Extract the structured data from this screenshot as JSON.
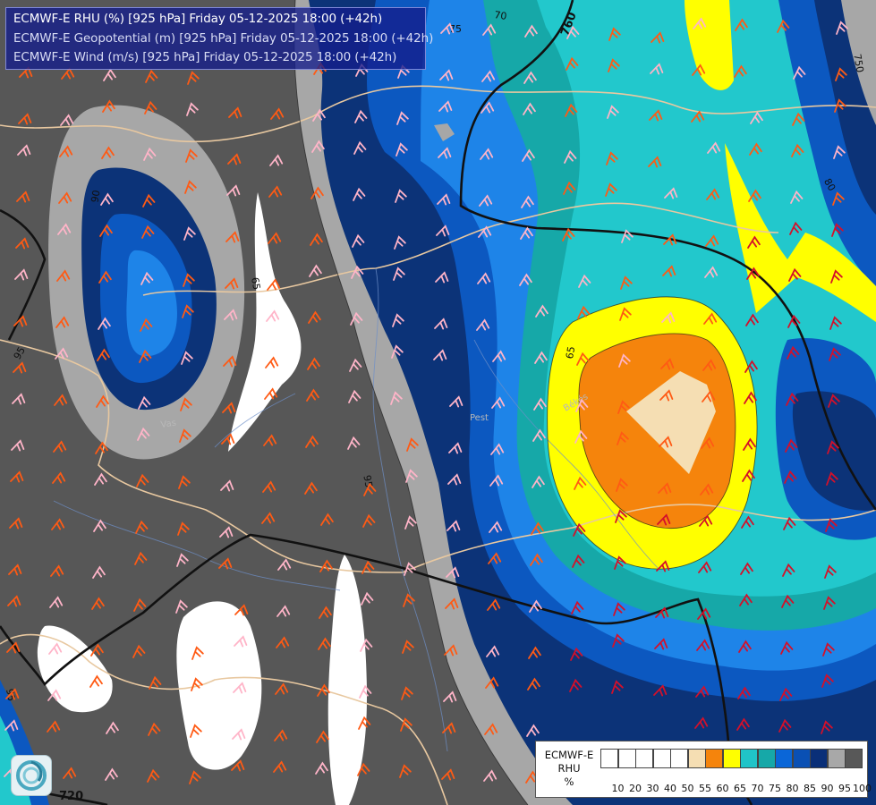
{
  "title": {
    "line1": "ECMWF-E RHU (%) [925 hPa] Friday 05-12-2025 18:00 (+42h)",
    "line2": "ECMWF-E Geopotential (m) [925 hPa] Friday 05-12-2025 18:00 (+42h)",
    "line3": "ECMWF-E Wind (m/s) [925 hPa] Friday 05-12-2025 18:00 (+42h)"
  },
  "legend": {
    "label_line1": "ECMWF-E",
    "label_line2": "RHU",
    "label_line3": "%",
    "ticks": [
      "10",
      "20",
      "30",
      "40",
      "50",
      "55",
      "60",
      "65",
      "70",
      "75",
      "80",
      "85",
      "90",
      "95",
      "100"
    ],
    "colors": [
      "#ffffff",
      "#ffffff",
      "#ffffff",
      "#ffffff",
      "#ffffff",
      "#f5deb3",
      "#f5840c",
      "#ffff00",
      "#20c4c8",
      "#16a8a8",
      "#0a66d8",
      "#0a50b4",
      "#0a2f78",
      "#a8a8a8",
      "#585858"
    ]
  },
  "isohypse_labels": [
    "70",
    "75",
    "760",
    "80",
    "90",
    "95",
    "65",
    "720",
    "750",
    "95",
    "65",
    "95"
  ],
  "place_labels": [
    "Vas",
    "Pest",
    "Békés"
  ],
  "colors": {
    "dark_gray": "#575757",
    "light_gray": "#a5a5a5",
    "navy": "#0c3378",
    "blue": "#0c58c0",
    "bright_blue": "#1e84e8",
    "teal": "#1aa5a5",
    "cyan": "#22c8cc",
    "yellow": "#ffff00",
    "orange": "#f5840c",
    "wheat": "#f5deb3",
    "barb_orange": "#ff5a14",
    "barb_pink": "#ffb4c8",
    "barb_red": "#d4102a",
    "contour_black": "#111111",
    "border_tan": "#e8c8a0",
    "title_box": "#1a1f8c"
  }
}
